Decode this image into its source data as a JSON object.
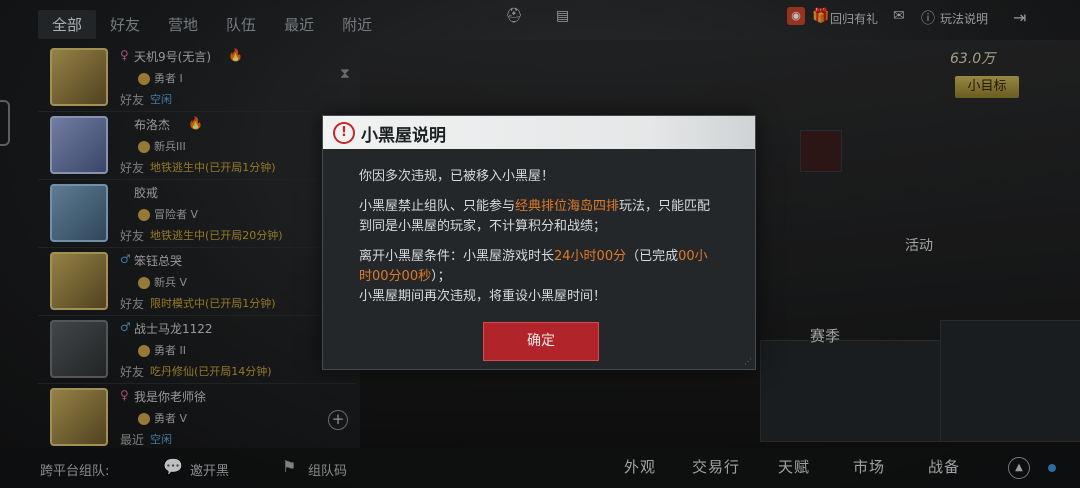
{
  "tabs": [
    "全部",
    "好友",
    "营地",
    "队伍",
    "最近",
    "附近"
  ],
  "friends": [
    {
      "name": "天机9号(无言)",
      "gender": "♀",
      "rank": "勇者 I",
      "relation": "好友",
      "status": "空闲",
      "status_color": "blue",
      "has_flame": true
    },
    {
      "name": "布洛杰",
      "gender": "",
      "rank": "新兵III",
      "relation": "好友",
      "status": "地铁逃生中(已开局1分钟)",
      "status_color": "gold",
      "has_flame": true
    },
    {
      "name": "胶戒",
      "gender": "",
      "rank": "冒险者 V",
      "relation": "好友",
      "status": "地铁逃生中(已开局20分钟)",
      "status_color": "gold",
      "has_flame": false
    },
    {
      "name": "笨钰总哭",
      "gender": "♂",
      "rank": "新兵 V",
      "relation": "好友",
      "status": "限时模式中(已开局1分钟)",
      "status_color": "gold",
      "has_flame": false
    },
    {
      "name": "战士马龙1122",
      "gender": "♂",
      "rank": "勇者 II",
      "relation": "好友",
      "status": "吃丹修仙(已开局14分钟)",
      "status_color": "gold",
      "has_flame": false
    },
    {
      "name": "我是你老师徐",
      "gender": "♀",
      "rank": "勇者 V",
      "relation": "最近",
      "status": "空闲",
      "status_color": "blue",
      "has_flame": false
    }
  ],
  "bottom": {
    "cross_platform": "跨平台组队:",
    "wechat_label": "邀开黑",
    "team_code_label": "组队码",
    "nav": [
      "外观",
      "交易行",
      "天赋",
      "市场",
      "战备"
    ]
  },
  "top_right": {
    "return_gift": "回归有礼",
    "help": "玩法说明"
  },
  "currency": "63.0万",
  "gold_button": "小目标",
  "season_label": "赛季",
  "activity_label": "活动",
  "modal": {
    "title": "小黑屋说明",
    "line1": "你因多次违规，已被移入小黑屋！",
    "p2_a": "小黑屋禁止组队、只能参与",
    "p2_hl": "经典排位海岛四排",
    "p2_b": "玩法，只能匹配到同是小黑屋的玩家，不计算积分和战绩；",
    "p3_a": "离开小黑屋条件：小黑屋游戏时长",
    "p3_hl1": "24小时00分",
    "p3_b": "（已完成",
    "p3_hl2": "00小时00分00秒",
    "p3_c": "）；",
    "p3_d": "小黑屋期间再次违规，将重设小黑屋时间！",
    "ok_label": "确定"
  },
  "colors": {
    "accent_red": "#b0242a",
    "highlight_orange": "#e07a2a",
    "status_blue": "#5aa0d8",
    "status_gold": "#c8a233"
  }
}
